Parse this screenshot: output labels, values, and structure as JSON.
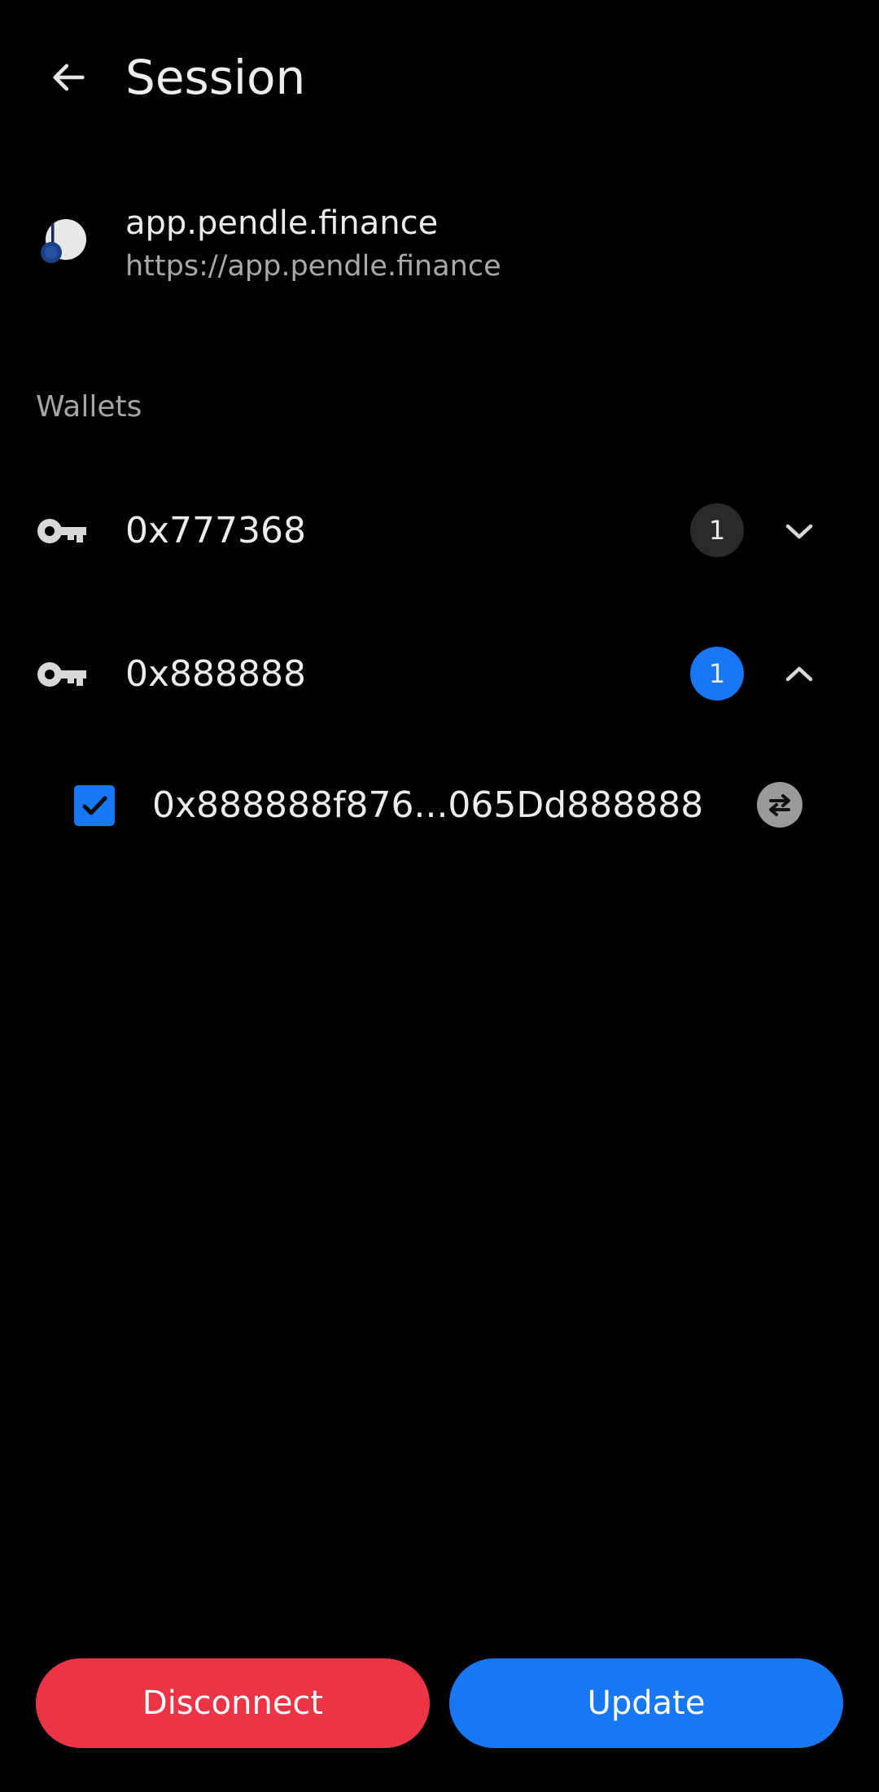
{
  "header": {
    "title": "Session",
    "back_icon": "arrow-left-icon"
  },
  "site": {
    "name": "app.pendle.finance",
    "url": "https://app.pendle.finance",
    "logo_icon": "pendle-logo-icon"
  },
  "wallets_section": {
    "label": "Wallets",
    "wallets": [
      {
        "name": "0x777368",
        "count": "1",
        "expanded": false,
        "badge_color": "#2a2a2a",
        "icon": "key-icon"
      },
      {
        "name": "0x888888",
        "count": "1",
        "expanded": true,
        "badge_color": "#1877f2",
        "icon": "key-icon",
        "accounts": [
          {
            "address": "0x888888f876...065Dd888888",
            "checked": true,
            "action_icon": "swap-arrows-icon"
          }
        ]
      }
    ]
  },
  "actions": {
    "disconnect_label": "Disconnect",
    "update_label": "Update"
  },
  "colors": {
    "background": "#000000",
    "accent": "#1877f2",
    "danger": "#eb3445",
    "text_primary": "#ececec",
    "text_secondary": "#a9a9a9"
  }
}
